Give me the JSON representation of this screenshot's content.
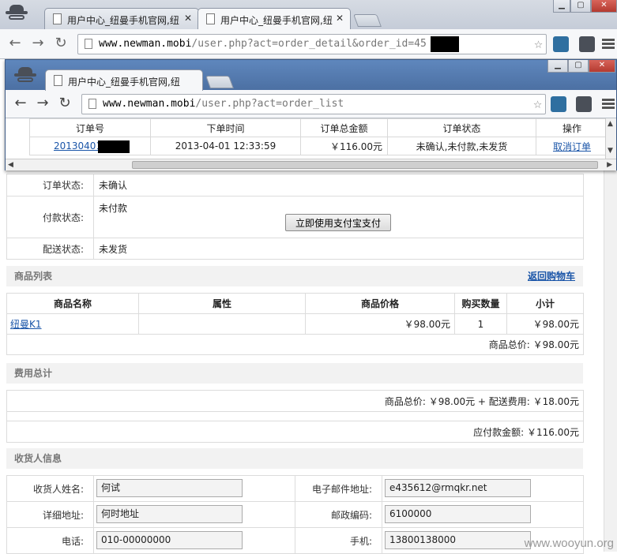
{
  "outer_browser": {
    "tabs": [
      {
        "title": "用户中心_纽曼手机官网,纽"
      },
      {
        "title": "用户中心_纽曼手机官网,纽"
      }
    ],
    "url_domain": "www.newman.mobi",
    "url_path": "/user.php?act=order_detail&order_id=45"
  },
  "inner_browser": {
    "tab_title": "用户中心_纽曼手机官网,纽",
    "url_domain": "www.newman.mobi",
    "url_path": "/user.php?act=order_list",
    "order_table": {
      "headers": [
        "订单号",
        "下单时间",
        "订单总金额",
        "订单状态",
        "操作"
      ],
      "row": {
        "order_id": "20130401",
        "time": "2013-04-01 12:33:59",
        "amount": "￥116.00元",
        "status": "未确认,未付款,未发货",
        "action": "取消订单"
      }
    }
  },
  "order_status": {
    "order_label": "订单状态:",
    "order_value": "未确认",
    "pay_label": "付款状态:",
    "pay_value": "未付款",
    "pay_button": "立即使用支付宝支付",
    "ship_label": "配送状态:",
    "ship_value": "未发货"
  },
  "goods": {
    "section_title": "商品列表",
    "back_link": "返回购物车",
    "headers": [
      "商品名称",
      "属性",
      "商品价格",
      "购买数量",
      "小计"
    ],
    "row": {
      "name": "纽曼K1",
      "attr": "",
      "price": "￥98.00元",
      "qty": "1",
      "subtotal": "￥98.00元"
    },
    "total": "商品总价: ￥98.00元"
  },
  "fees": {
    "section_title": "费用总计",
    "summary": "商品总价: ￥98.00元 + 配送费用: ￥18.00元",
    "due": "应付款金额: ￥116.00元"
  },
  "consignee": {
    "section_title": "收货人信息",
    "name_label": "收货人姓名:",
    "name_value": "何试",
    "email_label": "电子邮件地址:",
    "email_value": "e435612@rmqkr.net",
    "address_label": "详细地址:",
    "address_value": "何时地址",
    "zip_label": "邮政编码:",
    "zip_value": "6100000",
    "phone_label": "电话:",
    "phone_value": "010-00000000",
    "mobile_label": "手机:",
    "mobile_value": "13800138000"
  },
  "watermark": "www.wooyun.org"
}
